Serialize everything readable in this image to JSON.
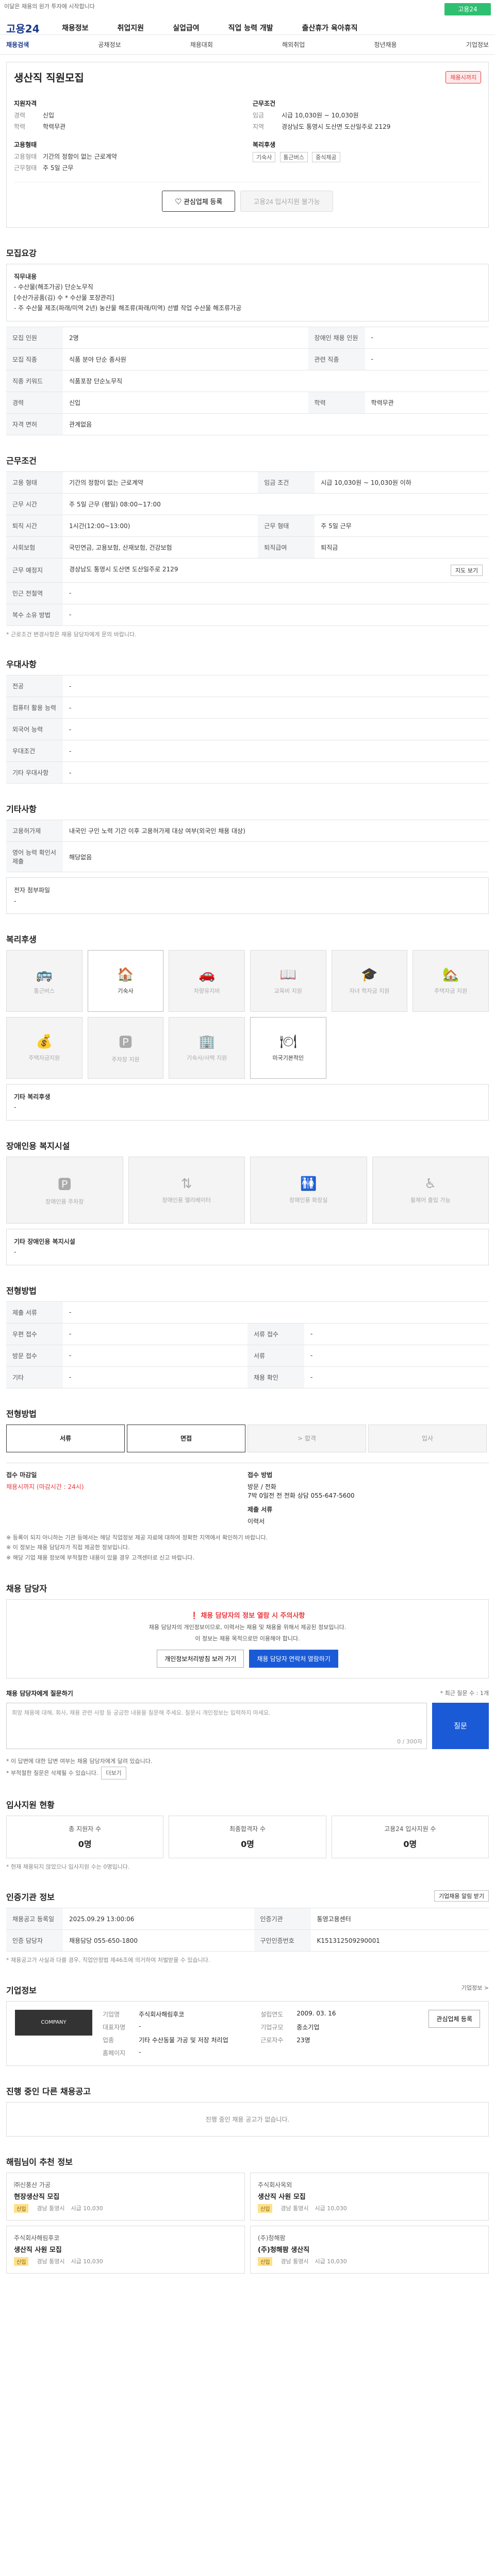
{
  "header": {
    "notice": "이달은 채용의 원가 투자에 시작합니다",
    "top_button": "고용24",
    "logo": "고용24",
    "gnb": [
      "채용정보",
      "취업지원",
      "실업급여",
      "직업 능력 개발",
      "출산휴가 육아휴직"
    ]
  },
  "subnav": [
    "채용검색",
    "공채정보",
    "채용대회",
    "해외취업",
    "청년채용",
    "기업정보"
  ],
  "job": {
    "title": "생산직 직원모집",
    "badge": "채용시까지",
    "left_head": "지원자격",
    "career_k": "경력",
    "career_v": "신입",
    "edu_k": "학력",
    "edu_v": "학력무관",
    "type_head": "고용형태",
    "type_k": "고용형태",
    "type_v": "기간의 정함이 없는 근로계약",
    "work_k": "근무형태",
    "work_v": "주 5일 근무",
    "right_head": "근무조건",
    "pay_k": "임금",
    "pay_v": "시급 10,030원 ~ 10,030원",
    "loc_k": "지역",
    "loc_v": "경상남도 통영시 도산면 도산일주로 2129",
    "welfare_head": "복리후생",
    "welfare_pills": [
      "기숙사",
      "통근버스",
      "중식제공"
    ],
    "btn_interest": "관심업체 등록",
    "btn_apply": "고용24 입사지원 불가능"
  },
  "recruit": {
    "title": "모집요강",
    "box_head": "직무내용",
    "box_lines": [
      "- 수산물(해조가공) 단순노무직",
      "[수산가공품(김) 수 * 수산물 포장관리]",
      "- 주 수산물 제조(파래/미역 2년) 농산물 해조류(파래/미역) 선별 작업 수산물 해조류가공"
    ],
    "rows": [
      {
        "k1": "모집 인원",
        "v1": "2명",
        "k2": "장애인 채용 인원",
        "v2": "-"
      },
      {
        "k1": "모집 직종",
        "v1": "식품 분야 단순 종사원",
        "k2": "관련 직종",
        "v2": "-"
      },
      {
        "k1": "직종 키워드",
        "v1": "식품포장 단순노무직"
      },
      {
        "k1": "경력",
        "v1": "신입",
        "k2": "학력",
        "v2": "학력무관"
      },
      {
        "k1": "자격 면허",
        "v1": "관계없음"
      }
    ]
  },
  "conditions": {
    "title": "근무조건",
    "rows": [
      {
        "k1": "고용 형태",
        "v1": "기간의 정함이 없는 근로계약",
        "k2": "임금 조건",
        "v2": "시급 10,030원 ~ 10,030원 이하"
      },
      {
        "k1": "근무 시간",
        "v1": "주 5일 근무 (평일) 08:00~17:00",
        "k2": "",
        "v2": ""
      },
      {
        "k1": "퇴직 시간",
        "v1": "1시간(12:00~13:00)",
        "k2": "근무 형태",
        "v2": "주 5일 근무"
      },
      {
        "k1": "사회보험",
        "v1": "국민연금, 고용보험, 산재보험, 건강보험",
        "k2": "퇴직급여",
        "v2": "퇴직금"
      },
      {
        "k1": "근무 예정지",
        "v1": "경상남도 통영시 도산면 도산일주로 2129",
        "k2": "",
        "v2": ""
      },
      {
        "k1": "인근 전철역",
        "v1": "-",
        "k2": "",
        "v2": ""
      },
      {
        "k1": "복수 소유 방법",
        "v1": "-",
        "k2": "",
        "v2": ""
      }
    ],
    "map_btn": "지도 보기",
    "note": "* 근로조건 변경사항은 채용 담당자에게 문의 바랍니다."
  },
  "preference": {
    "title": "우대사항",
    "rows": [
      {
        "k": "전공",
        "v": "-"
      },
      {
        "k": "컴퓨터 활용 능력",
        "v": "-"
      },
      {
        "k": "외국어 능력",
        "v": "-"
      },
      {
        "k": "우대조건",
        "v": "-"
      },
      {
        "k": "기타 우대사항",
        "v": "-"
      }
    ]
  },
  "etc": {
    "title": "기타사항",
    "rows": [
      {
        "k": "고용허가제",
        "v": "내국인 구인 노력 기간 이후 고용허가제 대상 여부(외국인 채용 대상)"
      },
      {
        "k": "영어 능력 확인서 제출",
        "v": "해당없음"
      }
    ],
    "box": "전자 첨부파일\n-"
  },
  "welfare": {
    "title": "복리후생",
    "items": [
      {
        "label": "통근버스",
        "on": false
      },
      {
        "label": "기숙사",
        "on": true
      },
      {
        "label": "차량유지비",
        "on": false
      },
      {
        "label": "교육비 지원",
        "on": false
      },
      {
        "label": "자녀 학자금 지원",
        "on": false
      },
      {
        "label": "주택자금 지원",
        "on": false
      },
      {
        "label": "주택자금지원",
        "on": false
      },
      {
        "label": "주차장 지원",
        "on": false
      },
      {
        "label": "기숙사/사택 지원",
        "on": false
      },
      {
        "label": "미국기본적인",
        "on": false
      },
      {
        "label": "",
        "on": false
      },
      {
        "label": "",
        "on": false
      }
    ],
    "box_head": "기타 복리후생",
    "box_val": "-"
  },
  "disability": {
    "title": "장애인용 복지시설",
    "items": [
      "장애인용 주차장",
      "장애인용 엘리베이터",
      "장애인용 화장실",
      "휠체어 출입 가능"
    ],
    "box_head": "기타 장애인용 복지시설",
    "box_val": "-"
  },
  "apply_doc": {
    "title": "전형방법",
    "rows": [
      {
        "k1": "제출 서류",
        "v1": "-",
        "k2": "",
        "v2": ""
      },
      {
        "k1": "우편 접수",
        "v1": "-",
        "k2": "서류 접수",
        "v2": "-"
      },
      {
        "k1": "방문 접수",
        "v1": "-",
        "k2": "서류",
        "v2": "-"
      },
      {
        "k1": "기타",
        "v1": "-",
        "k2": "채용 확인",
        "v2": "-"
      }
    ]
  },
  "process": {
    "title": "전형방법",
    "steps": [
      "서류",
      "면접",
      "> 합격",
      "입사"
    ],
    "method_label": "접수 마감일",
    "method_value": "채용시까지 (마감시간 : 24시)",
    "method_label2": "접수 방법",
    "method_value2": "방문 / 전화",
    "method_value3": "7박 0일전 전 전화 상담 055-647-5600",
    "method_label4": "제출 서류",
    "method_value4": "이력서",
    "notes": [
      "※ 등록이 되지 아니하는 기관 등에서는 해당 직업정보 제공 자료에 대하여 정확한 지역에서 확인하기 바랍니다.",
      "※ 이 정보는 채용 담당자가 직접 제공한 정보입니다.",
      "※ 해당 기업 채용 정보에 부적절한 내용이 있을 경우 고객센터로 신고 바랍니다."
    ]
  },
  "contact": {
    "title": "채용 담당자",
    "head": "채용 담당자의 정보 열람 시 주의사항",
    "p1": "채용 담당자의 개인정보이므로, 이력서는 채용 및 채용을 위해서 제공된 정보입니다.",
    "p2": "이 정보는 채용 목적으로만 이용해야 합니다.",
    "btn1": "개인정보처리방침 보러 가기",
    "btn2": "채용 담당자 연락처 열람하기",
    "qa_title": "채용 담당자에게 질문하기",
    "qa_note": "* 최근 질문 수 : 1개",
    "qa_placeholder": "희망 채용에 대해, 회사, 채용 관련 사항 등 궁금한 내용을 질문해 주세요. 질문시 개인정보는 입력하지 마세요.",
    "qa_count": "0 / 300자",
    "qa_btn": "질문",
    "notes": [
      "* 이 답변에 대한 답변 여부는 채용 담당자에게 달려 있습니다.",
      "* 부적절한 질문은 삭제될 수 있습니다."
    ],
    "more_btn": "더보기"
  },
  "status": {
    "title": "입사지원 현황",
    "items": [
      {
        "label": "총 지원자 수",
        "value": "0명"
      },
      {
        "label": "최종합격자 수",
        "value": "0명"
      },
      {
        "label": "고용24 입사지원 수",
        "value": "0명"
      }
    ],
    "note": "* 현재 채용되지 않았으나 입사지원 수는 0명입니다."
  },
  "info": {
    "title": "인증기관 정보",
    "right_btn": "기업채용 알림 받기",
    "rows": [
      {
        "k1": "채용공고 등록일",
        "v1": "2025.09.29 13:00:06",
        "k2": "인증기관",
        "v2": "통영고용센터"
      },
      {
        "k1": "인증 담당자",
        "v1": "채용담당 055-650-1800",
        "k2": "구인인증번호",
        "v2": "K151312509290001"
      }
    ],
    "note": "* 채용공고가 사실과 다를 경우, 직업안정법 제46조에 의거하여 처벌받을 수 있습니다."
  },
  "company": {
    "title": "기업정보",
    "more": "기업정보 >",
    "img_label": "COMPANY",
    "name_k": "기업명",
    "name_v": "주식회사해림후코",
    "ceo_k": "대표자명",
    "ceo_v": "-",
    "biz_k": "업종",
    "biz_v": "기타 수산동물 가공 및 저장 처리업",
    "found_k": "설립연도",
    "found_v": "2009. 03. 16",
    "size_k": "기업규모",
    "size_v": "중소기업",
    "emp_k": "근로자수",
    "emp_v": "23명",
    "addr_k": "홈페이지",
    "addr_v": "-",
    "btn": "관심업체 등록"
  },
  "other_jobs": {
    "title": "진행 중인 다른 채용공고",
    "empty": "진행 중인 채용 공고가 없습니다."
  },
  "recommend": {
    "title": "해림님이 추천 정보",
    "cards": [
      {
        "company": "㈜신풍산 가공",
        "title": "현장생산직 모집",
        "badge": "신입",
        "m1": "경남 통영시",
        "m2": "시급 10,030"
      },
      {
        "company": "주식회사옥외",
        "title": "생산직 사원 모집",
        "badge": "신입",
        "m1": "경남 통영시",
        "m2": "시급 10,030"
      },
      {
        "company": "주식회사해림후코",
        "title": "생산직 사원 모집",
        "badge": "신입",
        "m1": "경남 통영시",
        "m2": "시급 10,030"
      },
      {
        "company": "(주)청해팜",
        "title": "(주)청해팜 생산직",
        "badge": "신입",
        "m1": "경남 통영시",
        "m2": "시급 10,030"
      }
    ]
  }
}
